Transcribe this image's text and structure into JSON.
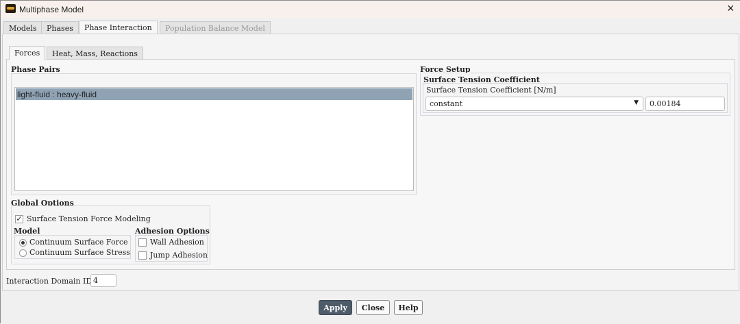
{
  "window": {
    "title": "Multiphase Model",
    "close_icon": "×"
  },
  "tabs": [
    "Models",
    "Phases",
    "Phase Interaction",
    "Population Balance Model"
  ],
  "subtabs": [
    "Forces",
    "Heat, Mass, Reactions"
  ],
  "phase_pairs": {
    "label": "Phase Pairs",
    "items": [
      "light-fluid : heavy-fluid"
    ]
  },
  "force_setup": {
    "label": "Force Setup",
    "group": "Surface Tension Coefficient",
    "field_label": "Surface Tension Coefficient [N/m]",
    "method": "constant",
    "value": "0.00184"
  },
  "global_options": {
    "label": "Global Options",
    "surface_tension_modeling": "Surface Tension Force Modeling",
    "model_label": "Model",
    "models": [
      "Continuum Surface Force",
      "Continuum Surface Stress"
    ],
    "adhesion_label": "Adhesion Options",
    "adhesion": [
      "Wall Adhesion",
      "Jump Adhesion"
    ]
  },
  "interaction_domain": {
    "label": "Interaction Domain ID",
    "value": "4"
  },
  "buttons": {
    "apply": "Apply",
    "close": "Close",
    "help": "Help"
  },
  "colors": {
    "selection": "#8fa3b5",
    "apply": "#4e5b68"
  }
}
